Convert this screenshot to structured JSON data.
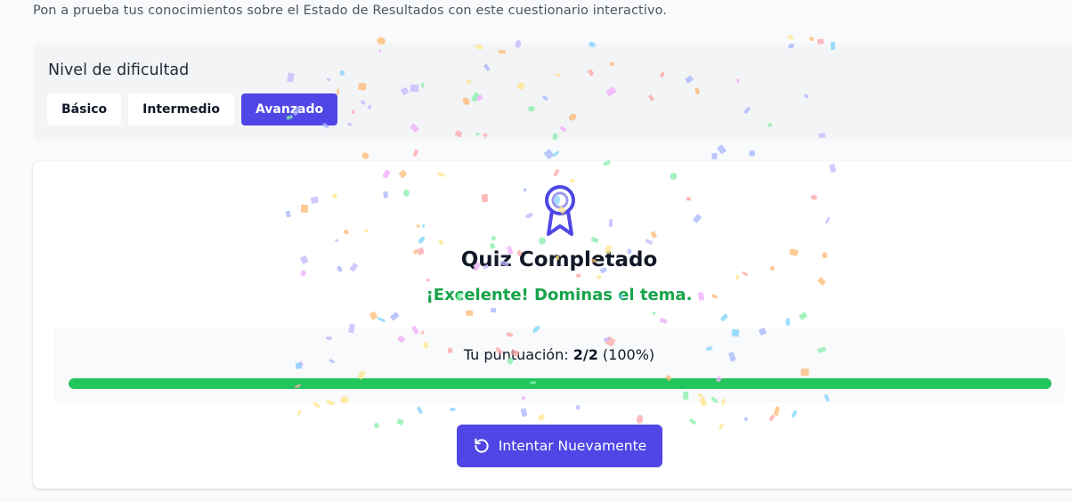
{
  "header": {
    "subtitle": "Pon a prueba tus conocimientos sobre el Estado de Resultados con este cuestionario interactivo."
  },
  "difficulty": {
    "title": "Nivel de dificultad",
    "levels": [
      {
        "label": "Básico",
        "active": false
      },
      {
        "label": "Intermedio",
        "active": false
      },
      {
        "label": "Avanzado",
        "active": true
      }
    ]
  },
  "result": {
    "icon": "award-icon",
    "title": "Quiz Completado",
    "message": "¡Excelente! Dominas el tema.",
    "score_label": "Tu puntuación:",
    "score_value": "2/2",
    "score_percent": "(100%)",
    "progress_fraction": 1.0,
    "retry_label": "Intentar Nuevamente",
    "retry_icon": "rotate-ccw-icon"
  },
  "colors": {
    "accent": "#4f46e5",
    "success_text": "#16a34a",
    "progress": "#22c55e",
    "panel": "#f3f4f6"
  }
}
